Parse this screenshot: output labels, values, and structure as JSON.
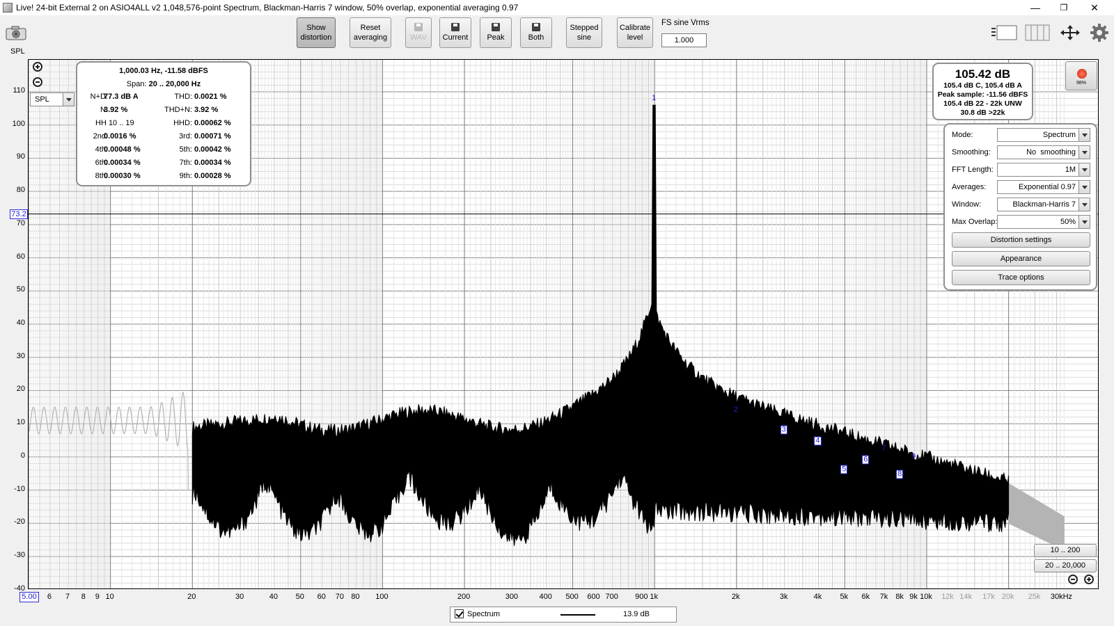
{
  "window": {
    "title": "Live! 24-bit External 2 on ASIO4ALL v2 1,048,576-point Spectrum, Blackman-Harris 7 window, 50% overlap, exponential averaging 0.97"
  },
  "toolbar": {
    "show_distortion": [
      "Show",
      "distortion"
    ],
    "reset_averaging": [
      "Reset",
      "averaging"
    ],
    "wav": "WAV",
    "current": "Current",
    "peak": "Peak",
    "both": "Both",
    "stepped_sine": [
      "Stepped",
      "sine"
    ],
    "calibrate_level": [
      "Calibrate",
      "level"
    ],
    "fs_label": "FS sine Vrms",
    "fs_value": "1.000",
    "spl_label": "SPL"
  },
  "y_axis": {
    "labels": [
      "110",
      "100",
      "90",
      "80",
      "70",
      "60",
      "50",
      "40",
      "30",
      "20",
      "10",
      "0",
      "-10",
      "-20",
      "-30",
      "-40"
    ],
    "cursor_value": "73.2",
    "unit_select": "SPL"
  },
  "x_axis": {
    "min_label": "5.00",
    "labels": [
      "6",
      "7",
      "8",
      "9",
      "10",
      "20",
      "30",
      "40",
      "50",
      "60",
      "70",
      "80",
      "100",
      "200",
      "300",
      "400",
      "500",
      "600",
      "700",
      "900",
      "1k",
      "2k",
      "3k",
      "4k",
      "5k",
      "6k",
      "7k",
      "8k",
      "9k",
      "10k",
      "12k",
      "14k",
      "17k",
      "20k",
      "25k",
      "30kHz"
    ]
  },
  "distortion": {
    "freq_line": "1,000.03 Hz, -11.58 dBFS",
    "span_label": "Span:",
    "span_value": "20 .. 20,000 Hz",
    "nd_label": "N+D:",
    "nd_value": "77.3 dB A",
    "thd_label": "THD:",
    "thd_value": "0.0021 %",
    "n_label": "N:",
    "n_value": "3.92 %",
    "thdn_label": "THD+N:",
    "thdn_value": "3.92 %",
    "hh_label": "HH 10 .. 19",
    "hhd_label": "HHD:",
    "hhd_value": "0.00062 %",
    "h2_label": "2nd:",
    "h2_value": "0.0016 %",
    "h3_label": "3rd:",
    "h3_value": "0.00071 %",
    "h4_label": "4th:",
    "h4_value": "0.00048 %",
    "h5_label": "5th:",
    "h5_value": "0.00042 %",
    "h6_label": "6th:",
    "h6_value": "0.00034 %",
    "h7_label": "7th:",
    "h7_value": "0.00034 %",
    "h8_label": "8th:",
    "h8_value": "0.00030 %",
    "h9_label": "9th:",
    "h9_value": "0.00028 %"
  },
  "spl_meter": {
    "big": "105.42 dB",
    "line1": "105.4 dB C, 105.4 dB A",
    "line2": "Peak sample: -11.56 dBFS",
    "line3": "105.4 dB 22 - 22k UNW",
    "line4": "30.8 dB >22k",
    "record_percent": "98%"
  },
  "settings": {
    "mode_label": "Mode:",
    "mode_value": "Spectrum",
    "smoothing_label": "Smoothing:",
    "smoothing_value": "No  smoothing",
    "fft_label": "FFT Length:",
    "fft_value": "1M",
    "averages_label": "Averages:",
    "averages_value": "Exponential 0.97",
    "window_label": "Window:",
    "window_value": "Blackman-Harris 7",
    "overlap_label": "Max Overlap:",
    "overlap_value": "50%",
    "distortion_settings": "Distortion settings",
    "appearance": "Appearance",
    "trace_options": "Trace options"
  },
  "range_buttons": {
    "low": "10 .. 200",
    "full": "20 .. 20,000"
  },
  "harmonic_markers": [
    "1",
    "2",
    "3",
    "4",
    "5",
    "6",
    "7",
    "8",
    "9"
  ],
  "legend": {
    "name": "Spectrum",
    "value": "13.9 dB"
  },
  "colors": {
    "trace": "#000000",
    "trace_out_of_span": "#b4b4b4",
    "marker": "#2020d0",
    "grid_major": "#7a7a7a",
    "grid_minor": "#d4d4d4"
  }
}
